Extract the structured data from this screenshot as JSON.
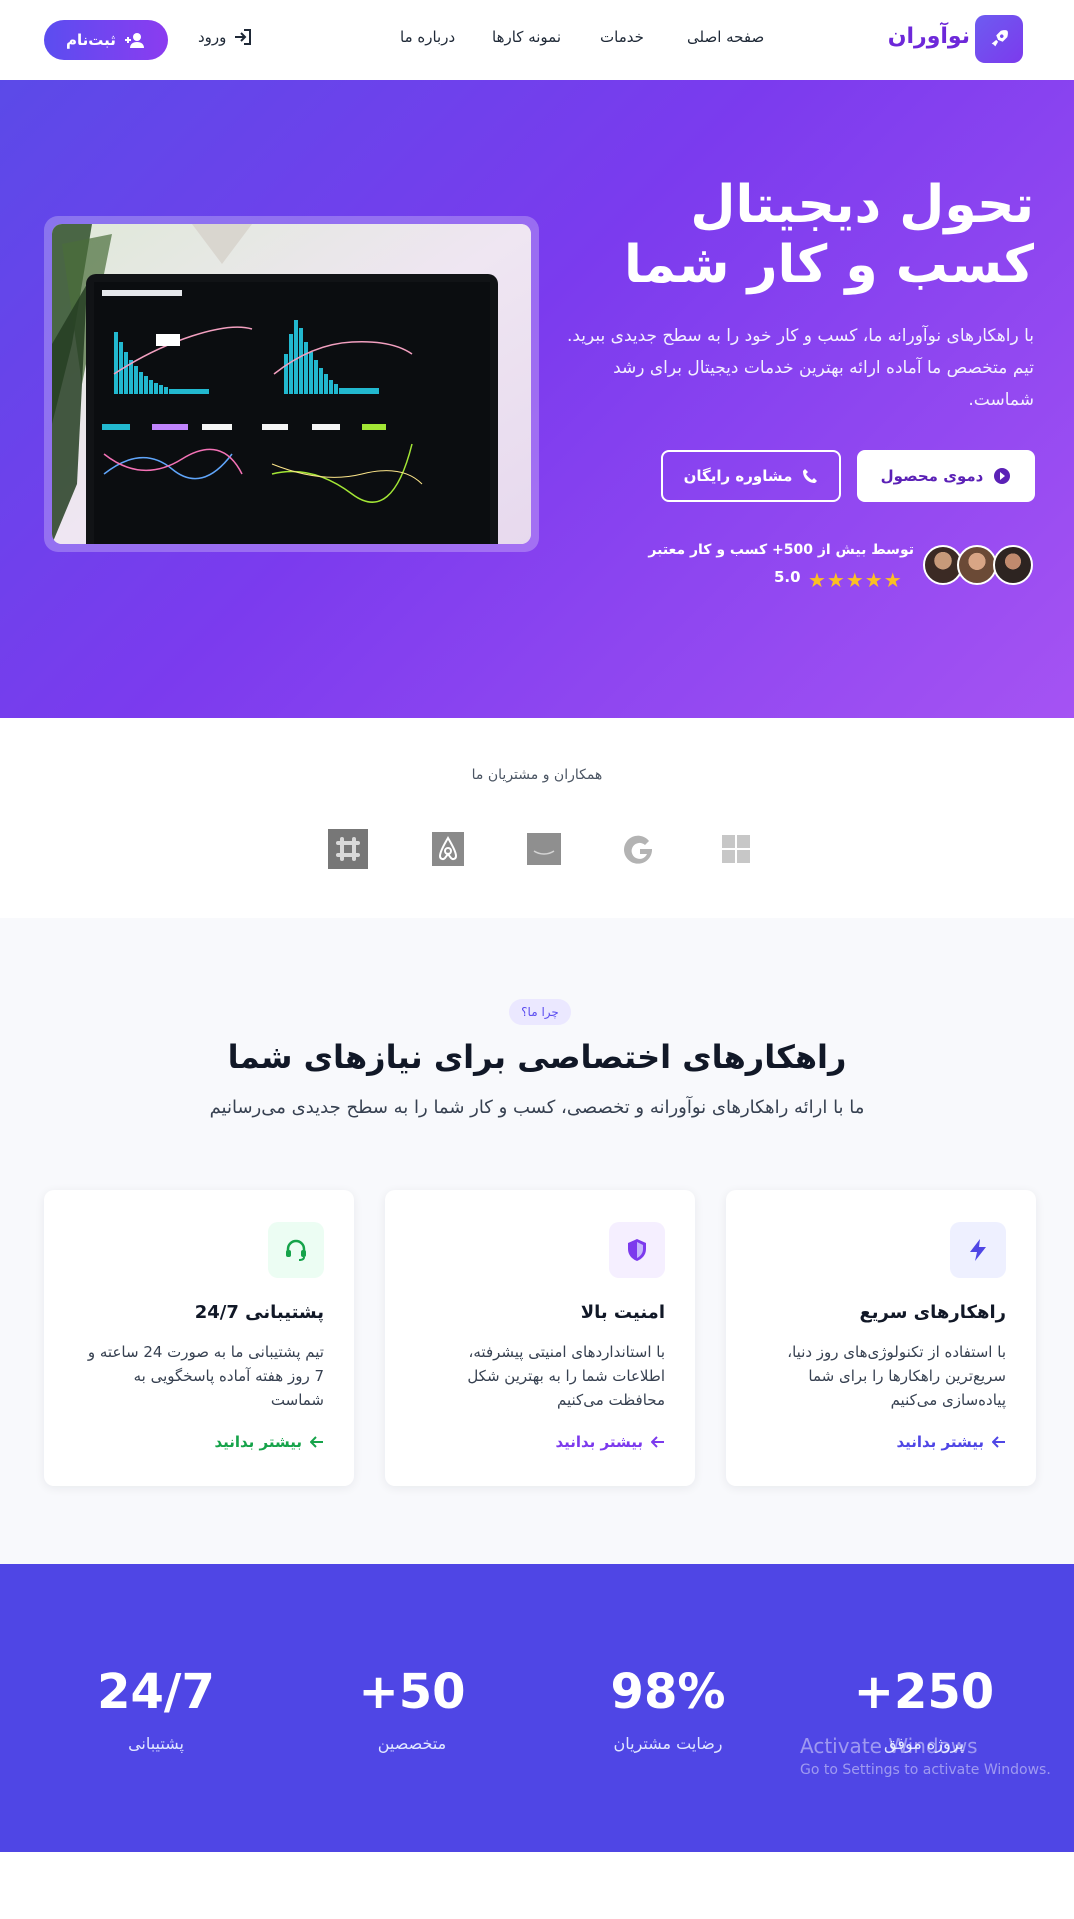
{
  "nav": {
    "brand": "نوآوران",
    "links": [
      "صفحه اصلی",
      "خدمات",
      "نمونه کارها",
      "درباره ما"
    ],
    "login": "ورود",
    "signup": "ثبت‌نام"
  },
  "hero": {
    "title_line1": "تحول دیجیتال",
    "title_line2": "کسب و کار شما",
    "description": "با راهکارهای نوآورانه ما، کسب و کار خود را به سطح جدیدی ببرید. تیم متخصص ما آماده ارائه بهترین خدمات دیجیتال برای رشد شماست.",
    "demo_button": "دموی محصول",
    "consult_button": "مشاوره رایگان",
    "trust_text": "توسط بیش از 500+ کسب و کار معتبر",
    "rating": "5.0",
    "stars": "★★★★★"
  },
  "partners": {
    "title": "همکاران و مشتریان ما",
    "logos": [
      "microsoft-logo",
      "google-logo",
      "amazon-logo",
      "airbnb-logo",
      "slack-logo"
    ]
  },
  "features": {
    "badge": "چرا ما؟",
    "title": "راهکارهای اختصاصی برای نیازهای شما",
    "subtitle": "ما با ارائه راهکارهای نوآورانه و تخصصی، کسب و کار شما را به سطح جدیدی می‌رسانیم",
    "cards": [
      {
        "title": "راهکارهای سریع",
        "text": "با استفاده از تکنولوژی‌های روز دنیا، سریع‌ترین راهکارها را برای شما پیاده‌سازی می‌کنیم",
        "link": "بیشتر بدانید",
        "icon": "bolt-icon",
        "color": "#4f46e5",
        "bg": "#eef0ff"
      },
      {
        "title": "امنیت بالا",
        "text": "با استانداردهای امنیتی پیشرفته، اطلاعات شما را به بهترین شکل محافظت می‌کنیم",
        "link": "بیشتر بدانید",
        "icon": "shield-icon",
        "color": "#7c3aed",
        "bg": "#f5efff"
      },
      {
        "title": "پشتیبانی 24/7",
        "text": "تیم پشتیبانی ما به صورت 24 ساعته و 7 روز هفته آماده پاسخگویی به شماست",
        "link": "بیشتر بدانید",
        "icon": "headset-icon",
        "color": "#16a34a",
        "bg": "#ecfdf3"
      }
    ]
  },
  "stats": [
    {
      "value": "+250",
      "label": "پروژه موفق"
    },
    {
      "value": "98%",
      "label": "رضایت مشتریان"
    },
    {
      "value": "+50",
      "label": "متخصصین"
    },
    {
      "value": "24/7",
      "label": "پشتیبانی"
    }
  ],
  "watermark": {
    "line1": "Activate Windows",
    "line2": "Go to Settings to activate Windows."
  }
}
